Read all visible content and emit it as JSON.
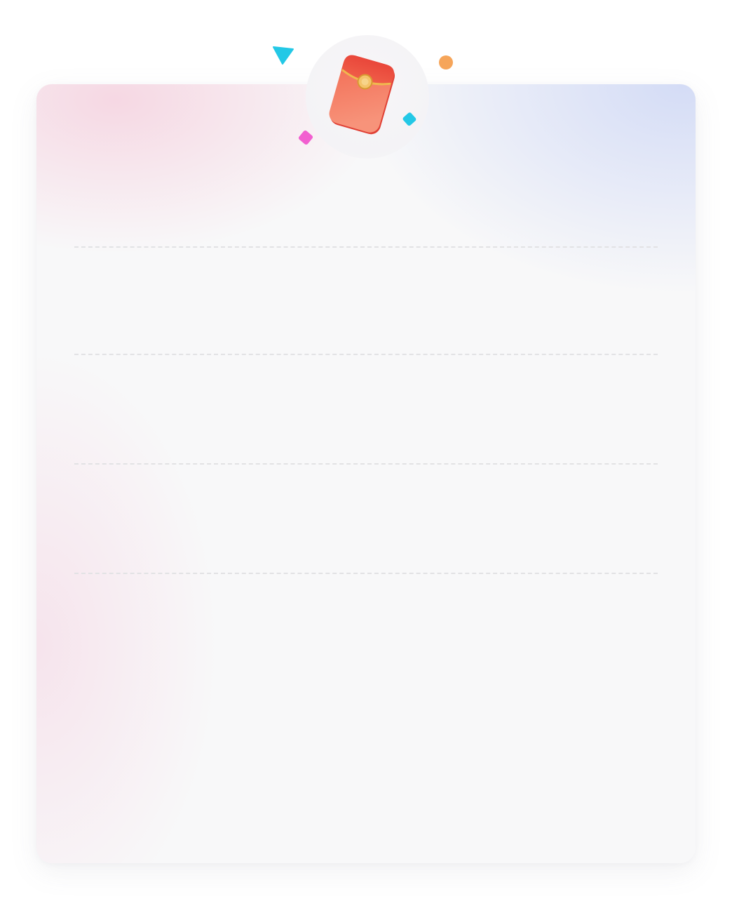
{
  "page": {
    "background_color": "#ffffff",
    "card_color": "#f8f8f9",
    "divider_color": "#e2e2e4"
  },
  "badge": {
    "icon": "red-envelope-icon",
    "colors": {
      "envelope_top": "#f05a45",
      "envelope_body": "#f58a6e",
      "seal": "#f4c46a"
    }
  },
  "confetti": [
    {
      "icon": "triangle-confetti-icon",
      "color": "#23c8e6"
    },
    {
      "icon": "circle-confetti-icon",
      "color": "#f6a55a"
    },
    {
      "icon": "diamond-confetti-icon",
      "color": "#f25fd0"
    },
    {
      "icon": "diamond-confetti-icon",
      "color": "#23c8e6"
    }
  ],
  "rows": [
    {
      "text": ""
    },
    {
      "text": ""
    },
    {
      "text": ""
    },
    {
      "text": ""
    },
    {
      "text": ""
    }
  ]
}
